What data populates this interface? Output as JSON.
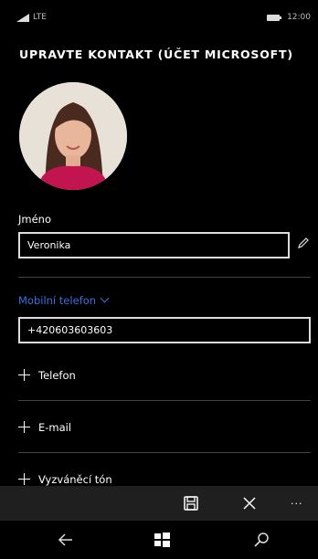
{
  "status": {
    "network": "LTE",
    "time": "12:00"
  },
  "header": {
    "title": "UPRAVTE KONTAKT (ÚČET MICROSOFT)"
  },
  "contact": {
    "name_label": "Jméno",
    "name_value": "Veronika",
    "phone_type_label": "Mobilní telefon",
    "phone_value": "+420603603603"
  },
  "add_rows": {
    "phone": "Telefon",
    "email": "E-mail",
    "nickname": "Vyzváněcí tón"
  },
  "app_bar": {
    "more_label": "..."
  },
  "icons": {
    "save": "save-icon",
    "close": "close-icon",
    "back": "back-arrow-icon",
    "start": "windows-logo-icon",
    "search": "search-icon"
  }
}
